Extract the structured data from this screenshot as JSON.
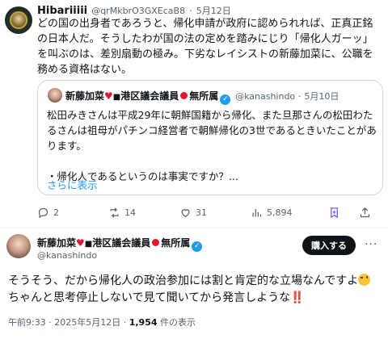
{
  "reply": {
    "display_name": "Hibariiiii",
    "handle": "@qrMkbrO3GXEcaB8",
    "sep": "·",
    "date": "5月12日",
    "text": "どの国の出身者であろうと、帰化申請が政府に認められれば、正真正銘の日本人だ。そうしたわが国の法の定めを踏みにじり「帰化人ガーッ」を叫ぶのは、差別扇動の極み。下劣なレイシストの新藤加菜に、公職を務める資格はない。"
  },
  "quote": {
    "name_part1": "新藤加菜",
    "name_part2": "港区議会議員",
    "name_part3": "無所属",
    "handle": "@kanashindo",
    "sep": "·",
    "date": "5月10日",
    "text_line1": "松田みきさんは平成29年に朝鮮国籍から帰化、また旦那さんの松田わたるさんは祖母がパチンコ経営者で朝鮮帰化の3世であるときいたことがあります。",
    "text_line2": "・帰化人であるというのは事実ですか？...",
    "show_more": "さらに表示"
  },
  "actions": {
    "replies": "2",
    "reposts": "14",
    "likes": "31",
    "views": "5,894"
  },
  "main": {
    "name_part1": "新藤加菜",
    "name_part2": "港区議会議員",
    "name_part3": "無所属",
    "handle": "@kanashindo",
    "buy_button": "購入する",
    "more": "···",
    "text_line1": "そうそう、だから帰化人の政治参加には割と肯定的な立場なんですよ",
    "text_line2": "ちゃんと思考停止しないで見て聞いてから発言しような",
    "excl": "‼️",
    "time": "午前9:33",
    "meta_sep": "·",
    "date": "2025年5月12日",
    "views_count": "1,954",
    "views_label": "件の表示"
  },
  "icons": [
    "reply-icon",
    "repost-icon",
    "like-icon",
    "views-icon",
    "bookmark-icon",
    "share-icon",
    "verified-icon",
    "flag-icon",
    "wink-emoji-icon"
  ],
  "colors": {
    "accent": "#1d9bf0",
    "text": "#0f1419",
    "muted": "#536471",
    "bookmark": "#7856ff",
    "red": "#e0172d"
  }
}
